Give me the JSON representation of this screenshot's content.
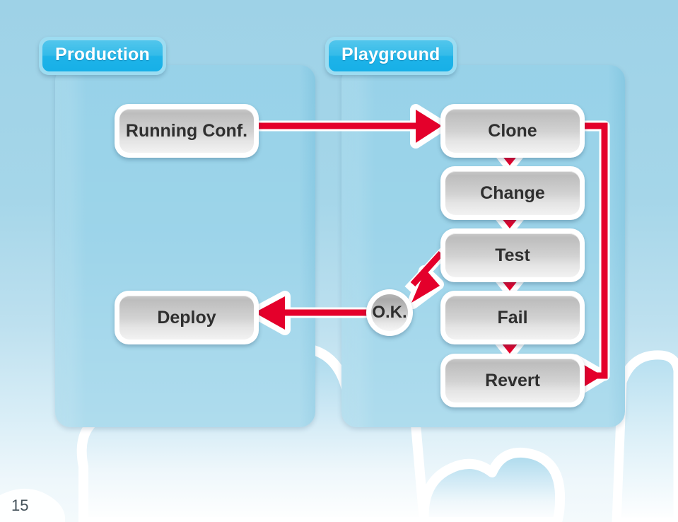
{
  "slide": {
    "page_number": "15",
    "background_color": "#a3d5e8",
    "accent_color": "#e4002b",
    "tab_color": "#29b7e8",
    "panel_color": "#8ccde6"
  },
  "panels": [
    {
      "id": "production",
      "title": "Production"
    },
    {
      "id": "playground",
      "title": "Playground"
    }
  ],
  "nodes": [
    {
      "id": "running-conf",
      "label": "Running Conf.",
      "shape": "box",
      "panel": "production"
    },
    {
      "id": "deploy",
      "label": "Deploy",
      "shape": "box",
      "panel": "production"
    },
    {
      "id": "ok",
      "label": "O.K.",
      "shape": "circle",
      "panel": "between"
    },
    {
      "id": "clone",
      "label": "Clone",
      "shape": "box",
      "panel": "playground"
    },
    {
      "id": "change",
      "label": "Change",
      "shape": "box",
      "panel": "playground"
    },
    {
      "id": "test",
      "label": "Test",
      "shape": "box",
      "panel": "playground"
    },
    {
      "id": "fail",
      "label": "Fail",
      "shape": "box",
      "panel": "playground"
    },
    {
      "id": "revert",
      "label": "Revert",
      "shape": "box",
      "panel": "playground"
    }
  ],
  "connections": [
    {
      "from": "running-conf",
      "to": "clone",
      "direction": "right"
    },
    {
      "from": "clone",
      "to": "change",
      "direction": "down"
    },
    {
      "from": "change",
      "to": "test",
      "direction": "down"
    },
    {
      "from": "test",
      "to": "ok",
      "direction": "down-left"
    },
    {
      "from": "ok",
      "to": "deploy",
      "direction": "left"
    },
    {
      "from": "test",
      "to": "fail",
      "direction": "down"
    },
    {
      "from": "fail",
      "to": "revert",
      "direction": "down"
    },
    {
      "from": "revert",
      "to": "clone",
      "direction": "right-up-loop"
    }
  ]
}
